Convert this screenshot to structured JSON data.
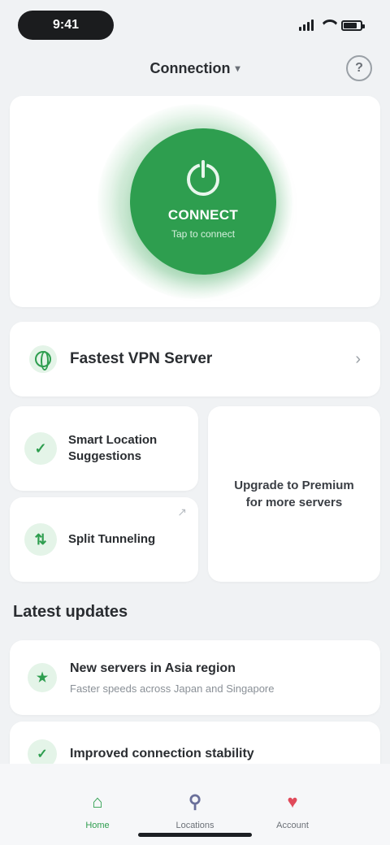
{
  "status_bar": {
    "time": "9:41"
  },
  "nav": {
    "title": "Connection",
    "chevron": "▾",
    "help": "?"
  },
  "hero": {
    "button_label": "CONNECT",
    "button_sub": "Tap to connect",
    "power_icon": "power-icon",
    "color": "#2e9e4f"
  },
  "location": {
    "label": "Fastest VPN Server",
    "icon": "globe-icon",
    "chevron": "›"
  },
  "features": [
    {
      "label": "Smart Location Suggestions",
      "icon": "✓",
      "arrow": "›"
    },
    {
      "label": "Split Tunneling",
      "icon": "⇅",
      "arrow": "↗"
    }
  ],
  "promo": {
    "label": "Upgrade to Premium for more servers"
  },
  "section": {
    "title": "Latest updates"
  },
  "news": [
    {
      "title": "New servers in Asia region",
      "desc": "Faster speeds across Japan and Singapore",
      "icon": "★"
    },
    {
      "title": "Improved connection stability",
      "desc": "",
      "icon": "✓"
    }
  ],
  "tabs": [
    {
      "label": "Home",
      "icon": "⌂",
      "color": "#2e9e4f",
      "active": true
    },
    {
      "label": "Locations",
      "icon": "⚲",
      "color": "#6a6f9a",
      "active": false
    },
    {
      "label": "Account",
      "icon": "♥",
      "color": "#e04a5a",
      "active": false
    }
  ]
}
